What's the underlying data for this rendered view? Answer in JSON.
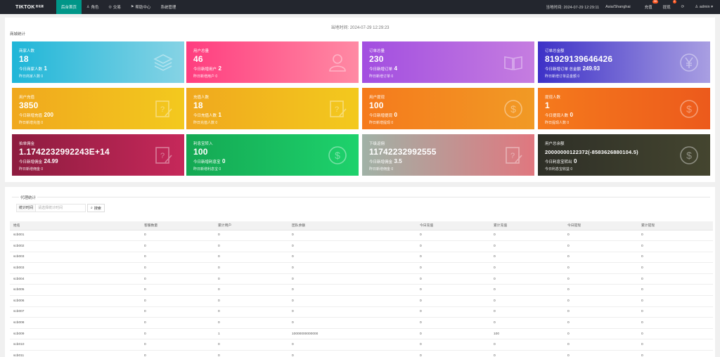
{
  "topbar": {
    "brand": "TIKTOK",
    "brand_sup": "优化版",
    "nav": [
      {
        "label": "后台首页",
        "icon": "",
        "active": true
      },
      {
        "label": "角色",
        "icon": "user-icon"
      },
      {
        "label": "交易",
        "icon": "trade-icon"
      },
      {
        "label": "帮助中心",
        "icon": "flag-icon"
      },
      {
        "label": "系统管理",
        "icon": ""
      }
    ],
    "server_time": "当地时间: 2024-07-29 12:29:11",
    "timezone": "Asia/Shanghai",
    "recharge": {
      "label": "充值",
      "badge": "96"
    },
    "withdraw": {
      "label": "提现",
      "badge": "1"
    },
    "refresh_icon": "refresh-icon",
    "user": "admin"
  },
  "clock": "当地时间: 2024-07-29 12:29:23",
  "stats_title": "商城统计",
  "cards": [
    {
      "title": "商家人数",
      "value": "18",
      "l1_label": "今日商家人数",
      "l1_value": "1",
      "l2": "昨日商家人数 0",
      "icon": "layers-icon",
      "gradient": [
        "#1fb6d8",
        "#86d3e5"
      ]
    },
    {
      "title": "用户总量",
      "value": "46",
      "l1_label": "今日新增用户",
      "l1_value": "2",
      "l2": "昨日新增用户 0",
      "icon": "users-icon",
      "gradient": [
        "#ff3d7f",
        "#ff8aa4"
      ]
    },
    {
      "title": "订单总量",
      "value": "230",
      "l1_label": "今日新增订单",
      "l1_value": "4",
      "l2": "昨日新增订单 0",
      "icon": "book-icon",
      "gradient": [
        "#a24ee0",
        "#c57de0"
      ]
    },
    {
      "title": "订单总金额",
      "value": "81929139646426",
      "l1_label": "今日新增订单 总金额",
      "l1_value": "249.93",
      "l2": "昨日新增订单总金额 0",
      "icon": "yen-icon",
      "gradient": [
        "#3d31c7",
        "#a99fe2"
      ]
    },
    {
      "title": "用户充值",
      "value": "3850",
      "l1_label": "今日新增充值",
      "l1_value": "200",
      "l2": "昨日新增充值 0",
      "icon": "note-icon",
      "gradient": [
        "#f0a81e",
        "#f3c91e"
      ]
    },
    {
      "title": "充值人数",
      "value": "18",
      "l1_label": "今日充值人数",
      "l1_value": "1",
      "l2": "昨日充值人数 0",
      "icon": "note-icon",
      "gradient": [
        "#f0a81e",
        "#f3c91e"
      ]
    },
    {
      "title": "用户提现",
      "value": "100",
      "l1_label": "今日新增提现",
      "l1_value": "0",
      "l2": "昨日新增提现 0",
      "icon": "dollar-icon",
      "gradient": [
        "#f57a1c",
        "#f19a25"
      ]
    },
    {
      "title": "提现人数",
      "value": "1",
      "l1_label": "今日提现人数",
      "l1_value": "0",
      "l2": "昨日提现人数 0",
      "icon": "dollar-icon",
      "gradient": [
        "#f57a1c",
        "#ec5a1c"
      ]
    },
    {
      "title": "拍单佣金",
      "value": "1.1742232992243E+14",
      "l1_label": "今日新增佣金",
      "l1_value": "24.99",
      "l2": "昨日新增佣金 0",
      "icon": "note-icon",
      "gradient": [
        "#8d1c3f",
        "#c6285a"
      ]
    },
    {
      "title": "利息宝转入",
      "value": "100",
      "l1_label": "今日新增利息宝",
      "l1_value": "0",
      "l2": "昨日新增利息宝 0",
      "icon": "dollar-icon",
      "gradient": [
        "#14a853",
        "#1ed26c"
      ]
    },
    {
      "title": "下级返佣",
      "value": "11742232992555",
      "l1_label": "今日新增佣金",
      "l1_value": "3.5",
      "l2": "昨日新增佣金 0",
      "icon": "note-icon",
      "gradient": [
        "#a0b2a6",
        "#e0777f"
      ]
    },
    {
      "title": "用户总余额",
      "value": "20000000122372(-8583626880104.5)",
      "small": true,
      "l1_label": "今日利息宝转出",
      "l1_value": "0",
      "l2": "今日利息宝收益 0",
      "icon": "dollar-icon",
      "gradient": [
        "#2e2f27",
        "#44452f"
      ]
    }
  ],
  "agent": {
    "title": "代理统计",
    "filter_label": "统计时间",
    "filter_placeholder": "请选择统计时间",
    "search_label": "搜索",
    "columns": [
      "姓名",
      "客服数量",
      "累计用户",
      "团队余额",
      "今日充值",
      "累计充值",
      "今日提现",
      "累计提现"
    ],
    "rows": [
      [
        "scb001",
        "0",
        "0",
        "0",
        "0",
        "0",
        "0",
        "0"
      ],
      [
        "scb002",
        "0",
        "0",
        "0",
        "0",
        "0",
        "0",
        "0"
      ],
      [
        "scb003",
        "0",
        "0",
        "0",
        "0",
        "0",
        "0",
        "0"
      ],
      [
        "scb003",
        "0",
        "0",
        "0",
        "0",
        "0",
        "0",
        "0"
      ],
      [
        "scb004",
        "0",
        "0",
        "0",
        "0",
        "0",
        "0",
        "0"
      ],
      [
        "scb005",
        "0",
        "0",
        "0",
        "0",
        "0",
        "0",
        "0"
      ],
      [
        "scb006",
        "0",
        "0",
        "0",
        "0",
        "0",
        "0",
        "0"
      ],
      [
        "scb007",
        "0",
        "0",
        "0",
        "0",
        "0",
        "0",
        "0"
      ],
      [
        "scb008",
        "0",
        "0",
        "0",
        "0",
        "0",
        "0",
        "0"
      ],
      [
        "scb009",
        "0",
        "1",
        "10000000000000",
        "0",
        "100",
        "0",
        "0"
      ],
      [
        "scb010",
        "0",
        "0",
        "0",
        "0",
        "0",
        "0",
        "0"
      ],
      [
        "scb011",
        "0",
        "0",
        "0",
        "0",
        "0",
        "0",
        "0"
      ]
    ]
  }
}
